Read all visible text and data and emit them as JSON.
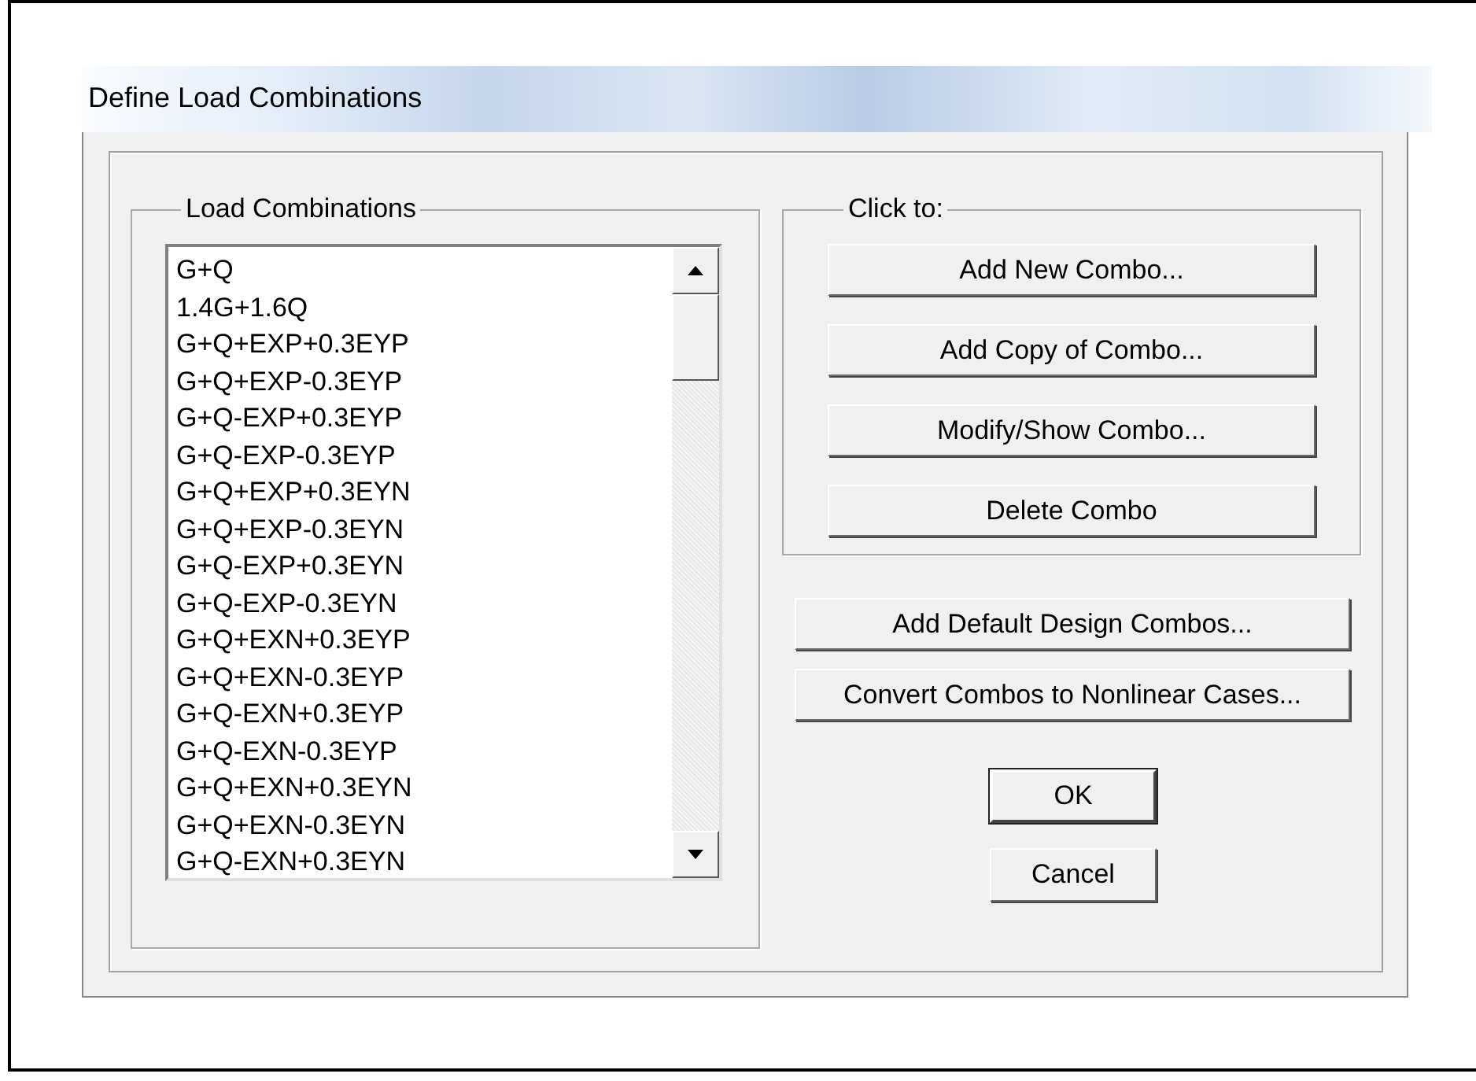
{
  "window": {
    "title": "Define Load Combinations"
  },
  "load_combinations": {
    "label": "Load Combinations",
    "items": [
      {
        "text": "G+Q",
        "selected": false
      },
      {
        "text": "1.4G+1.6Q",
        "selected": false
      },
      {
        "text": "G+Q+EXP+0.3EYP",
        "selected": false
      },
      {
        "text": "G+Q+EXP-0.3EYP",
        "selected": false
      },
      {
        "text": "G+Q-EXP+0.3EYP",
        "selected": false
      },
      {
        "text": "G+Q-EXP-0.3EYP",
        "selected": false
      },
      {
        "text": "G+Q+EXP+0.3EYN",
        "selected": false
      },
      {
        "text": "G+Q+EXP-0.3EYN",
        "selected": false
      },
      {
        "text": "G+Q-EXP+0.3EYN",
        "selected": false
      },
      {
        "text": "G+Q-EXP-0.3EYN",
        "selected": false
      },
      {
        "text": "G+Q+EXN+0.3EYP",
        "selected": false
      },
      {
        "text": "G+Q+EXN-0.3EYP",
        "selected": false
      },
      {
        "text": "G+Q-EXN+0.3EYP",
        "selected": false
      },
      {
        "text": "G+Q-EXN-0.3EYP",
        "selected": false
      },
      {
        "text": "G+Q+EXN+0.3EYN",
        "selected": false
      },
      {
        "text": "G+Q+EXN-0.3EYN",
        "selected": false
      },
      {
        "text": "G+Q-EXN+0.3EYN",
        "selected": false
      }
    ]
  },
  "click_to": {
    "label": "Click to:",
    "buttons": [
      "Add New Combo...",
      "Add Copy of Combo...",
      "Modify/Show Combo...",
      "Delete Combo"
    ]
  },
  "design_buttons": [
    "Add Default Design Combos...",
    "Convert Combos to Nonlinear Cases..."
  ],
  "dialog_buttons": [
    {
      "label": "OK",
      "default": true
    },
    {
      "label": "Cancel",
      "default": false
    }
  ]
}
